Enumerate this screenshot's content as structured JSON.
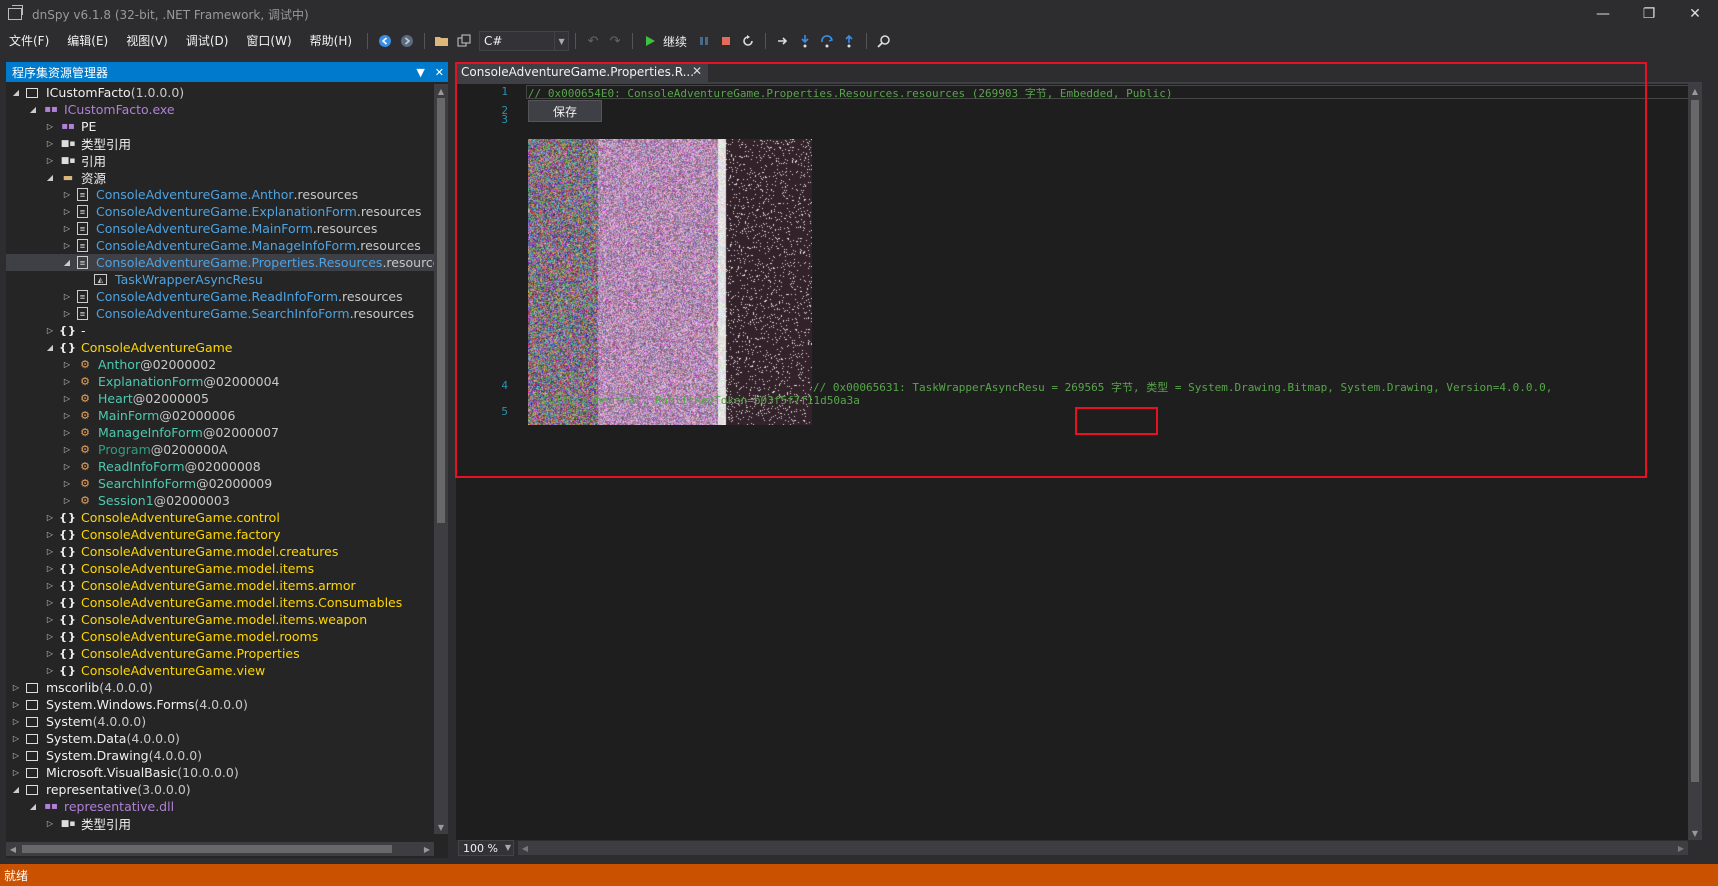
{
  "window": {
    "title": "dnSpy v6.1.8 (32-bit, .NET Framework, 调试中)",
    "minimize": "—",
    "restore": "❐",
    "close": "✕"
  },
  "menu": [
    "文件(F)",
    "编辑(E)",
    "视图(V)",
    "调试(D)",
    "窗口(W)",
    "帮助(H)"
  ],
  "toolbar": {
    "language": "C#",
    "continue_label": "继续"
  },
  "explorer": {
    "title": "程序集资源管理器",
    "rows": [
      {
        "indent": 0,
        "exp": "open",
        "icon": "assembly-icon",
        "parts": [
          [
            "ICustomFacto",
            "c-white"
          ],
          [
            " (1.0.0.0)",
            "c-dim"
          ]
        ]
      },
      {
        "indent": 1,
        "exp": "open",
        "icon": "module-icon",
        "parts": [
          [
            "ICustomFacto.exe",
            "c-purple"
          ]
        ]
      },
      {
        "indent": 2,
        "exp": "closed",
        "icon": "module-icon",
        "parts": [
          [
            "PE",
            "c-white"
          ]
        ]
      },
      {
        "indent": 2,
        "exp": "closed",
        "icon": "reference-icon",
        "parts": [
          [
            "类型引用",
            "c-white"
          ]
        ]
      },
      {
        "indent": 2,
        "exp": "closed",
        "icon": "reference-icon",
        "parts": [
          [
            "引用",
            "c-white"
          ]
        ]
      },
      {
        "indent": 2,
        "exp": "open",
        "icon": "folder-icon",
        "parts": [
          [
            "资源",
            "c-white"
          ]
        ]
      },
      {
        "indent": 3,
        "exp": "closed",
        "icon": "resource-icon",
        "parts": [
          [
            "ConsoleAdventureGame.Anthor",
            "c-blue"
          ],
          [
            ".resources",
            "c-dim"
          ]
        ]
      },
      {
        "indent": 3,
        "exp": "closed",
        "icon": "resource-icon",
        "parts": [
          [
            "ConsoleAdventureGame.ExplanationForm",
            "c-blue"
          ],
          [
            ".resources",
            "c-dim"
          ]
        ]
      },
      {
        "indent": 3,
        "exp": "closed",
        "icon": "resource-icon",
        "parts": [
          [
            "ConsoleAdventureGame.MainForm",
            "c-blue"
          ],
          [
            ".resources",
            "c-dim"
          ]
        ]
      },
      {
        "indent": 3,
        "exp": "closed",
        "icon": "resource-icon",
        "parts": [
          [
            "ConsoleAdventureGame.ManageInfoForm",
            "c-blue"
          ],
          [
            ".resources",
            "c-dim"
          ]
        ]
      },
      {
        "indent": 3,
        "exp": "open",
        "icon": "resource-icon",
        "selected": true,
        "parts": [
          [
            "ConsoleAdventureGame.Properties.Resources",
            "c-blue"
          ],
          [
            ".resources",
            "c-dim"
          ]
        ]
      },
      {
        "indent": 4,
        "exp": "none",
        "icon": "image-icon",
        "parts": [
          [
            "TaskWrapperAsyncResu",
            "c-blue"
          ]
        ]
      },
      {
        "indent": 3,
        "exp": "closed",
        "icon": "resource-icon",
        "parts": [
          [
            "ConsoleAdventureGame.ReadInfoForm",
            "c-blue"
          ],
          [
            ".resources",
            "c-dim"
          ]
        ]
      },
      {
        "indent": 3,
        "exp": "closed",
        "icon": "resource-icon",
        "parts": [
          [
            "ConsoleAdventureGame.SearchInfoForm",
            "c-blue"
          ],
          [
            ".resources",
            "c-dim"
          ]
        ]
      },
      {
        "indent": 2,
        "exp": "closed",
        "icon": "namespace-icon",
        "parts": [
          [
            "-",
            "c-white"
          ]
        ]
      },
      {
        "indent": 2,
        "exp": "open",
        "icon": "namespace-icon",
        "parts": [
          [
            "ConsoleAdventureGame",
            "c-yellow"
          ]
        ]
      },
      {
        "indent": 3,
        "exp": "closed",
        "icon": "class-icon",
        "parts": [
          [
            "Anthor",
            "c-type"
          ],
          [
            " @02000002",
            "c-dim"
          ]
        ]
      },
      {
        "indent": 3,
        "exp": "closed",
        "icon": "class-icon",
        "parts": [
          [
            "ExplanationForm",
            "c-type"
          ],
          [
            " @02000004",
            "c-dim"
          ]
        ]
      },
      {
        "indent": 3,
        "exp": "closed",
        "icon": "class-icon",
        "parts": [
          [
            "Heart",
            "c-type"
          ],
          [
            " @02000005",
            "c-dim"
          ]
        ]
      },
      {
        "indent": 3,
        "exp": "closed",
        "icon": "class-icon",
        "parts": [
          [
            "MainForm",
            "c-type"
          ],
          [
            " @02000006",
            "c-dim"
          ]
        ]
      },
      {
        "indent": 3,
        "exp": "closed",
        "icon": "class-icon",
        "parts": [
          [
            "ManageInfoForm",
            "c-type"
          ],
          [
            " @02000007",
            "c-dim"
          ]
        ]
      },
      {
        "indent": 3,
        "exp": "closed",
        "icon": "class-icon",
        "parts": [
          [
            "Program",
            "c-green-dim"
          ],
          [
            " @0200000A",
            "c-dim"
          ]
        ]
      },
      {
        "indent": 3,
        "exp": "closed",
        "icon": "class-icon",
        "parts": [
          [
            "ReadInfoForm",
            "c-type"
          ],
          [
            " @02000008",
            "c-dim"
          ]
        ]
      },
      {
        "indent": 3,
        "exp": "closed",
        "icon": "class-icon",
        "parts": [
          [
            "SearchInfoForm",
            "c-type"
          ],
          [
            " @02000009",
            "c-dim"
          ]
        ]
      },
      {
        "indent": 3,
        "exp": "closed",
        "icon": "class-icon",
        "parts": [
          [
            "Session1",
            "c-type"
          ],
          [
            " @02000003",
            "c-dim"
          ]
        ]
      },
      {
        "indent": 2,
        "exp": "closed",
        "icon": "namespace-icon",
        "parts": [
          [
            "ConsoleAdventureGame.control",
            "c-yellow"
          ]
        ]
      },
      {
        "indent": 2,
        "exp": "closed",
        "icon": "namespace-icon",
        "parts": [
          [
            "ConsoleAdventureGame.factory",
            "c-yellow"
          ]
        ]
      },
      {
        "indent": 2,
        "exp": "closed",
        "icon": "namespace-icon",
        "parts": [
          [
            "ConsoleAdventureGame.model.creatures",
            "c-yellow"
          ]
        ]
      },
      {
        "indent": 2,
        "exp": "closed",
        "icon": "namespace-icon",
        "parts": [
          [
            "ConsoleAdventureGame.model.items",
            "c-yellow"
          ]
        ]
      },
      {
        "indent": 2,
        "exp": "closed",
        "icon": "namespace-icon",
        "parts": [
          [
            "ConsoleAdventureGame.model.items.armor",
            "c-yellow"
          ]
        ]
      },
      {
        "indent": 2,
        "exp": "closed",
        "icon": "namespace-icon",
        "parts": [
          [
            "ConsoleAdventureGame.model.items.Consumables",
            "c-yellow"
          ]
        ]
      },
      {
        "indent": 2,
        "exp": "closed",
        "icon": "namespace-icon",
        "parts": [
          [
            "ConsoleAdventureGame.model.items.weapon",
            "c-yellow"
          ]
        ]
      },
      {
        "indent": 2,
        "exp": "closed",
        "icon": "namespace-icon",
        "parts": [
          [
            "ConsoleAdventureGame.model.rooms",
            "c-yellow"
          ]
        ]
      },
      {
        "indent": 2,
        "exp": "closed",
        "icon": "namespace-icon",
        "parts": [
          [
            "ConsoleAdventureGame.Properties",
            "c-yellow"
          ]
        ]
      },
      {
        "indent": 2,
        "exp": "closed",
        "icon": "namespace-icon",
        "parts": [
          [
            "ConsoleAdventureGame.view",
            "c-yellow"
          ]
        ]
      },
      {
        "indent": 0,
        "exp": "closed",
        "icon": "assembly-icon",
        "parts": [
          [
            "mscorlib",
            "c-white"
          ],
          [
            " (4.0.0.0)",
            "c-dim"
          ]
        ]
      },
      {
        "indent": 0,
        "exp": "closed",
        "icon": "assembly-icon",
        "parts": [
          [
            "System.Windows.Forms",
            "c-white"
          ],
          [
            " (4.0.0.0)",
            "c-dim"
          ]
        ]
      },
      {
        "indent": 0,
        "exp": "closed",
        "icon": "assembly-icon",
        "parts": [
          [
            "System",
            "c-white"
          ],
          [
            " (4.0.0.0)",
            "c-dim"
          ]
        ]
      },
      {
        "indent": 0,
        "exp": "closed",
        "icon": "assembly-icon",
        "parts": [
          [
            "System.Data",
            "c-white"
          ],
          [
            " (4.0.0.0)",
            "c-dim"
          ]
        ]
      },
      {
        "indent": 0,
        "exp": "closed",
        "icon": "assembly-icon",
        "parts": [
          [
            "System.Drawing",
            "c-white"
          ],
          [
            " (4.0.0.0)",
            "c-dim"
          ]
        ]
      },
      {
        "indent": 0,
        "exp": "closed",
        "icon": "assembly-icon",
        "parts": [
          [
            "Microsoft.VisualBasic",
            "c-white"
          ],
          [
            " (10.0.0.0)",
            "c-dim"
          ]
        ]
      },
      {
        "indent": 0,
        "exp": "open",
        "icon": "assembly-icon",
        "parts": [
          [
            "representative",
            "c-white"
          ],
          [
            " (3.0.0.0)",
            "c-dim"
          ]
        ]
      },
      {
        "indent": 1,
        "exp": "open",
        "icon": "module-icon",
        "parts": [
          [
            "representative.dll",
            "c-purple"
          ]
        ]
      },
      {
        "indent": 2,
        "exp": "closed",
        "icon": "reference-icon",
        "parts": [
          [
            "类型引用",
            "c-white"
          ]
        ]
      }
    ]
  },
  "editor": {
    "tab_title": "ConsoleAdventureGame.Properties.R...",
    "line1": "// 0x000654E0: ConsoleAdventureGame.Properties.Resources.resources (269903 字节, Embedded, Public)",
    "save_label": "保存",
    "line4_prefix": "// 0x00065631: TaskWrapperAsyncResu = ",
    "line4_bytes": "269565 字节",
    "line4_suffix": ", 类型 = System.Drawing.Bitmap, System.Drawing, Version=4.0.0.0,",
    "line4_cont": "Culture=neutral, PublicKeyToken=b03f5f7f11d50a3a",
    "line_numbers": [
      "1",
      "2",
      "3",
      "4",
      "5"
    ],
    "zoom": "100 %"
  },
  "status": {
    "text": "就绪"
  }
}
